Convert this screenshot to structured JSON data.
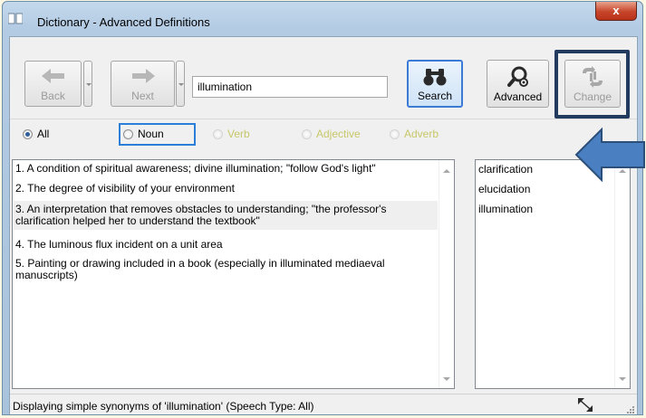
{
  "window": {
    "title": "Dictionary - Advanced Definitions",
    "close_label": "x"
  },
  "toolbar": {
    "back_label": "Back",
    "next_label": "Next",
    "search_value": "illumination",
    "search_label": "Search",
    "advanced_label": "Advanced",
    "change_label": "Change"
  },
  "speech_types": [
    {
      "label": "All",
      "checked": true
    },
    {
      "label": "Noun",
      "checked": false
    },
    {
      "label": "Verb",
      "checked": false
    },
    {
      "label": "Adjective",
      "checked": false
    },
    {
      "label": "Adverb",
      "checked": false
    }
  ],
  "definitions": [
    "1. A condition of spiritual awareness; divine illumination; \"follow God's light\"",
    "2. The degree of visibility of your environment",
    "3. An interpretation that removes obstacles to understanding; \"the professor's clarification helped her to understand the textbook\"",
    "4. The luminous flux incident on a unit area",
    "5. Painting or drawing included in a book (especially in illuminated mediaeval manuscripts)"
  ],
  "synonyms": [
    "clarification",
    "elucidation",
    "illumination"
  ],
  "status": {
    "text": "Displaying simple synonyms of 'illumination' (Speech Type: All)"
  },
  "colors": {
    "highlight_border": "#213a5e",
    "arrow_fill": "#4a7fc1",
    "radio_dim_text": "#c7c76a"
  },
  "icons": {
    "back": "arrow-left-icon",
    "next": "arrow-right-icon",
    "search": "binoculars-icon",
    "advanced": "magnifier-gear-icon",
    "change": "swap-icon",
    "annotation": "arrow-left-big-icon"
  }
}
